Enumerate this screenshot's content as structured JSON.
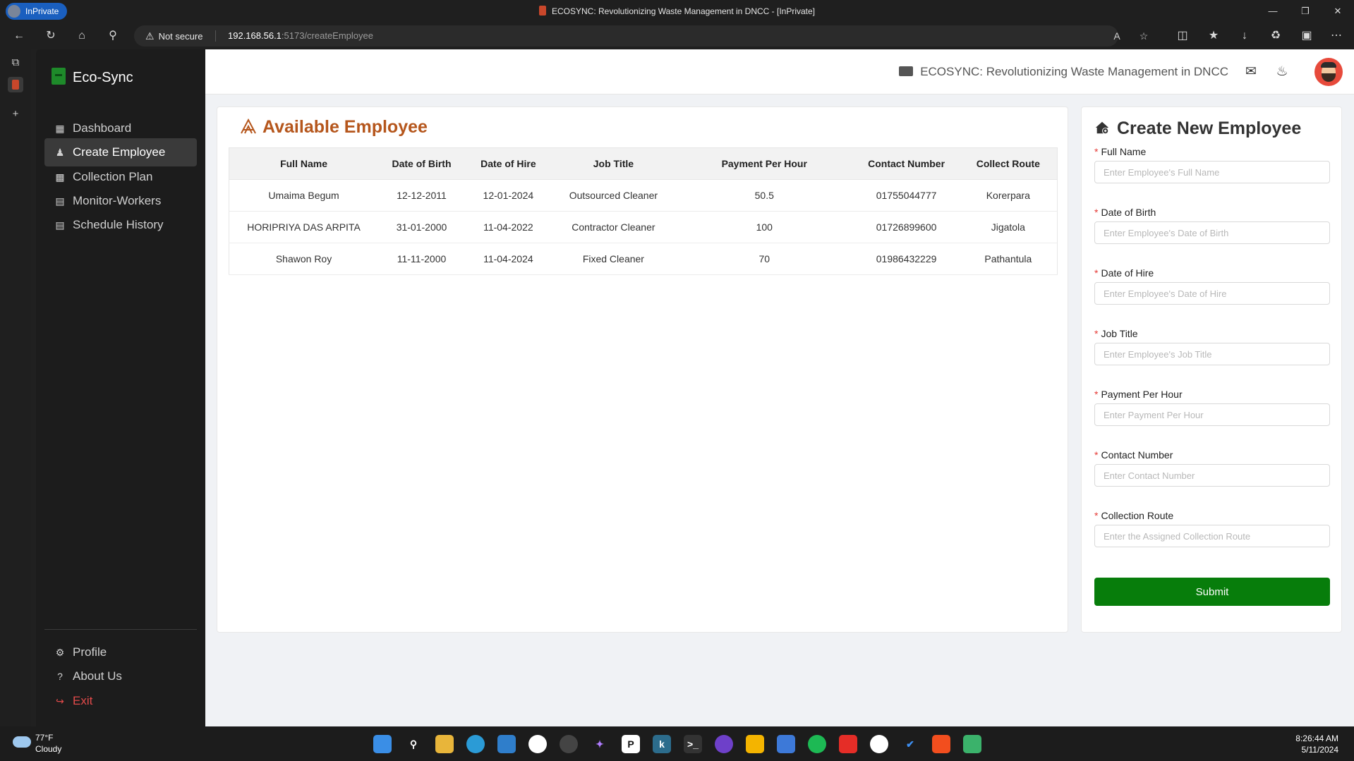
{
  "browser": {
    "inprivate_label": "InPrivate",
    "window_title": "ECOSYNC: Revolutionizing Waste Management in DNCC - [InPrivate]",
    "security_label": "Not secure",
    "url_host": "192.168.56.1",
    "url_path": ":5173/createEmployee"
  },
  "sidebar": {
    "brand": "Eco-Sync",
    "items": [
      {
        "label": "Dashboard",
        "icon": "dashboard-icon"
      },
      {
        "label": "Create Employee",
        "icon": "users-icon"
      },
      {
        "label": "Collection Plan",
        "icon": "plan-icon"
      },
      {
        "label": "Monitor-Workers",
        "icon": "monitor-icon"
      },
      {
        "label": "Schedule History",
        "icon": "history-icon"
      }
    ],
    "bottom_items": [
      {
        "label": "Profile",
        "icon": "gear-icon"
      },
      {
        "label": "About Us",
        "icon": "question-icon"
      },
      {
        "label": "Exit",
        "icon": "exit-icon"
      }
    ]
  },
  "header": {
    "app_title": "ECOSYNC: Revolutionizing Waste Management in DNCC"
  },
  "employee_list": {
    "title": "Available Employee",
    "columns": [
      "Full Name",
      "Date of Birth",
      "Date of Hire",
      "Job Title",
      "Payment Per Hour",
      "Contact Number",
      "Collect Route"
    ],
    "rows": [
      [
        "Umaima Begum",
        "12-12-2011",
        "12-01-2024",
        "Outsourced Cleaner",
        "50.5",
        "01755044777",
        "Korerpara"
      ],
      [
        "HORIPRIYA DAS ARPITA",
        "31-01-2000",
        "11-04-2022",
        "Contractor Cleaner",
        "100",
        "01726899600",
        "Jigatola"
      ],
      [
        "Shawon Roy",
        "11-11-2000",
        "11-04-2024",
        "Fixed Cleaner",
        "70",
        "01986432229",
        "Pathantula"
      ]
    ]
  },
  "form": {
    "title": "Create New Employee",
    "fields": [
      {
        "label": "Full Name",
        "placeholder": "Enter Employee's Full Name",
        "value": ""
      },
      {
        "label": "Date of Birth",
        "placeholder": "Enter Employee's Date of Birth",
        "value": ""
      },
      {
        "label": "Date of Hire",
        "placeholder": "Enter Employee's Date of Hire",
        "value": ""
      },
      {
        "label": "Job Title",
        "placeholder": "Enter Employee's Job Title",
        "value": ""
      },
      {
        "label": "Payment Per Hour",
        "placeholder": "Enter Payment Per Hour",
        "value": ""
      },
      {
        "label": "Contact Number",
        "placeholder": "Enter Contact Number",
        "value": ""
      },
      {
        "label": "Collection Route",
        "placeholder": "Enter the Assigned Collection Route",
        "value": ""
      }
    ],
    "submit_label": "Submit"
  },
  "taskbar": {
    "temperature": "77°F",
    "condition": "Cloudy",
    "time": "8:26:44 AM",
    "date": "5/11/2024"
  },
  "colors": {
    "accent_orange": "#b5561c",
    "submit_green": "#077d0b",
    "sidebar_bg": "#1c1c1c",
    "exit_red": "#e24a4a"
  }
}
